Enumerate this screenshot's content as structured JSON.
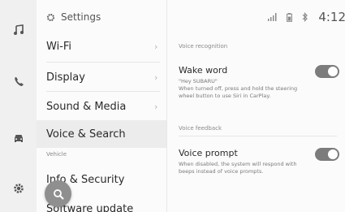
{
  "rail": {
    "icons": [
      "music-note-icon",
      "phone-icon",
      "car-icon",
      "settings-icon"
    ]
  },
  "menu": {
    "header_title": "Settings",
    "items": [
      {
        "label": "Wi-Fi",
        "chevron": "›"
      },
      {
        "label": "Display",
        "chevron": "›"
      },
      {
        "label": "Sound & Media",
        "chevron": "›"
      },
      {
        "label": "Voice & Search",
        "chevron": "",
        "selected": true
      }
    ],
    "section_vehicle": "Vehicle",
    "vehicle_items": [
      {
        "label": "Info & Security"
      },
      {
        "label": "Software update"
      }
    ]
  },
  "status_bar": {
    "time": "4:12",
    "icons": [
      "signal-icon",
      "battery-icon",
      "bluetooth-icon"
    ]
  },
  "content": {
    "section_recognition": "Voice recognition",
    "wake_word": {
      "title": "Wake word",
      "desc_line1": "\"Hey SUBARU\"",
      "desc_line2": "When turned off, press and hold the steering wheel button to use Siri in CarPlay.",
      "enabled": true
    },
    "section_feedback": "Voice feedback",
    "voice_prompt": {
      "title": "Voice prompt",
      "desc": "When disabled, the system will respond with beeps instead of voice prompts.",
      "enabled": true
    }
  },
  "colors": {
    "toggle_on": "#7c7c7c",
    "selected_bg": "#ececec",
    "rail_bg": "#f0f0f0"
  }
}
